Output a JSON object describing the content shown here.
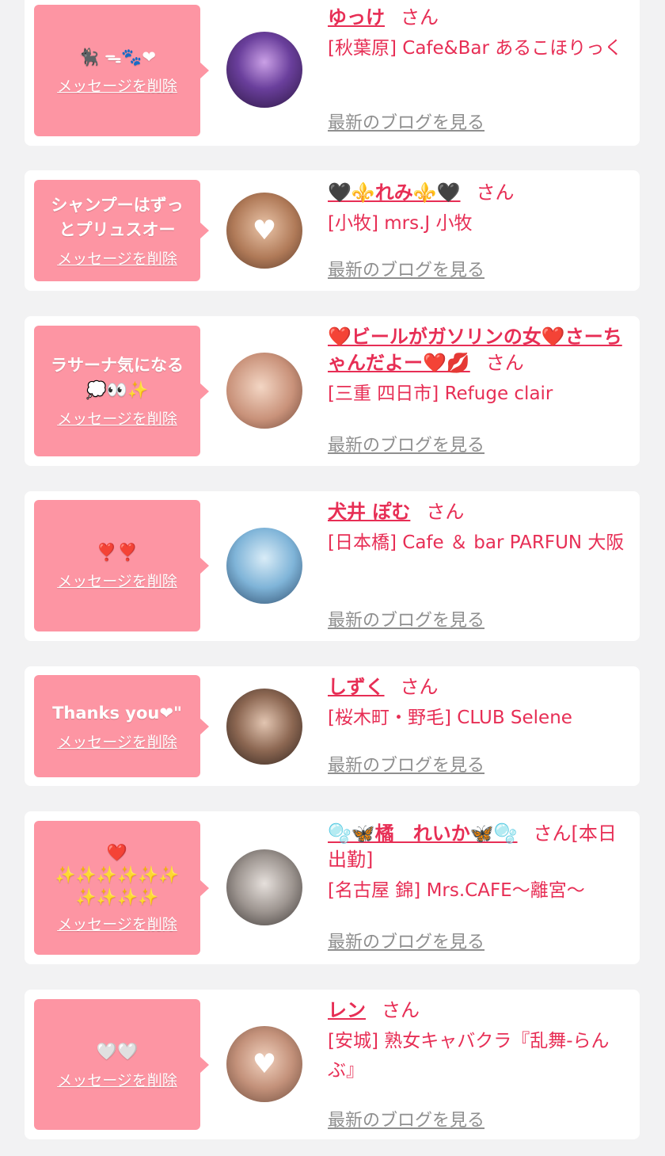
{
  "labels": {
    "delete": "メッセージを削除",
    "blog": "最新のブログを見る",
    "san": "さん"
  },
  "cards": [
    {
      "message": "🐈‍⬛︎ ᯓ🐾❤",
      "name": "ゆっけ",
      "san_suffix": "",
      "shop": "[秋葉原] Cafe&Bar あるこほりっく"
    },
    {
      "message": "シャンプーはずっ\nとプリュスオー",
      "name": "🖤⚜️れみ⚜️🖤",
      "san_suffix": "",
      "shop": "[小牧] mrs.J 小牧"
    },
    {
      "message": "ラサーナ気になる\n💭👀✨",
      "name": "❤️ビールがガソリンの女❤️さーちゃんだよー❤️💋",
      "san_suffix": "",
      "shop": "[三重 四日市] Refuge clair"
    },
    {
      "message": "❣️❣️",
      "name": "犬井 ぽむ",
      "san_suffix": "",
      "shop": "[日本橋] Cafe ＆ bar PARFUN 大阪"
    },
    {
      "message": "Thanks you❤︎\"",
      "name": "しずく",
      "san_suffix": "",
      "shop": "[桜木町・野毛] CLUB Selene"
    },
    {
      "message": "❤️\n✨✨✨✨✨✨\n✨✨✨✨",
      "name": "🫧🦋橘　れいか🦋🫧",
      "san_suffix": "[本日出勤]",
      "shop": "[名古屋 錦] Mrs.CAFE～離宮～"
    },
    {
      "message": "🤍🤍",
      "name": "レン",
      "san_suffix": "",
      "shop": "[安城] 熟女キャバクラ『乱舞-らんぶ』"
    }
  ],
  "colors": {
    "accent": "#e72e55",
    "bubble": "#fd95a3",
    "background": "#f2f2f3",
    "link_gray": "#8f8f8f"
  }
}
